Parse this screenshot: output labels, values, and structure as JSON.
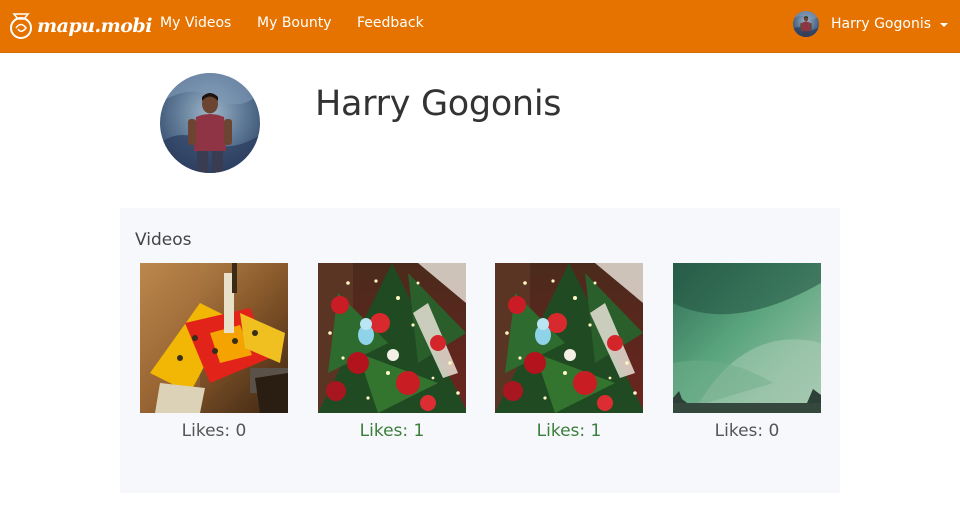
{
  "theme": {
    "navbar_bg": "#e67300",
    "panel_bg": "#f7f8fc",
    "liked_color": "#3b7d3b"
  },
  "navbar": {
    "brand": {
      "text": "mapu.mobi",
      "icon": "mapu-logo-icon"
    },
    "links": [
      {
        "label": "My Videos"
      },
      {
        "label": "My Bounty"
      },
      {
        "label": "Feedback"
      }
    ],
    "user": {
      "name": "Harry Gogonis",
      "avatar": "user-avatar",
      "dropdown_icon": "caret-down-icon"
    }
  },
  "profile": {
    "name": "Harry Gogonis",
    "avatar": "profile-photo"
  },
  "videos": {
    "heading": "Videos",
    "items": [
      {
        "thumbnail": "yellow-red-toy-robot",
        "likes_label": "Likes: 0",
        "likes": 0
      },
      {
        "thumbnail": "christmas-tree-ornaments",
        "likes_label": "Likes: 1",
        "likes": 1
      },
      {
        "thumbnail": "christmas-tree-ornaments",
        "likes_label": "Likes: 1",
        "likes": 1
      },
      {
        "thumbnail": "green-aurora-sky",
        "likes_label": "Likes: 0",
        "likes": 0
      }
    ]
  }
}
